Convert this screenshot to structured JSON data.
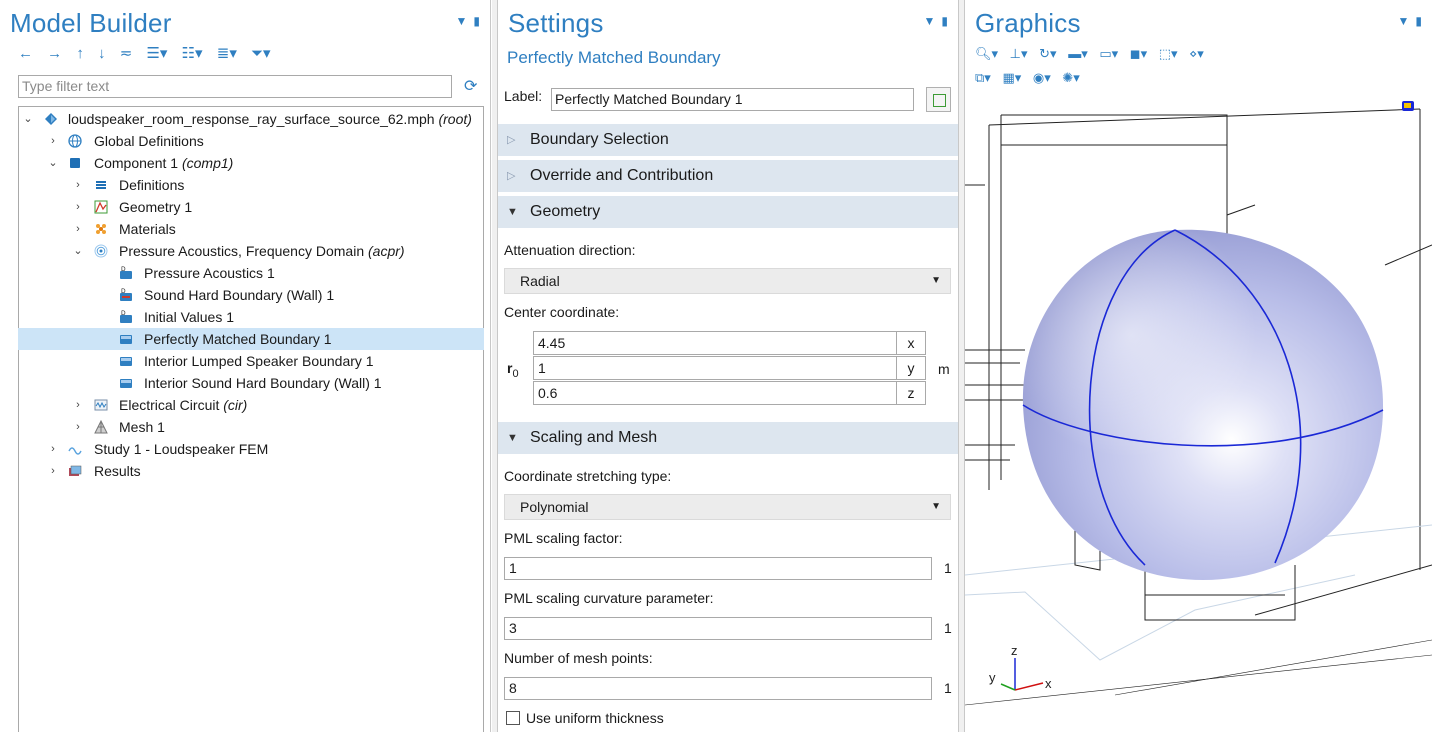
{
  "model_builder": {
    "title": "Model Builder",
    "filter_placeholder": "Type filter text",
    "tree": [
      {
        "label": "loudspeaker_room_response_ray_surface_source_62.mph",
        "tag": "(root)"
      },
      {
        "label": "Global Definitions",
        "tag": ""
      },
      {
        "label": "Component 1",
        "tag": "(comp1)"
      },
      {
        "label": "Definitions",
        "tag": ""
      },
      {
        "label": "Geometry 1",
        "tag": ""
      },
      {
        "label": "Materials",
        "tag": ""
      },
      {
        "label": "Pressure Acoustics, Frequency Domain",
        "tag": "(acpr)"
      },
      {
        "label": "Pressure Acoustics 1",
        "tag": ""
      },
      {
        "label": "Sound Hard Boundary (Wall) 1",
        "tag": ""
      },
      {
        "label": "Initial Values 1",
        "tag": ""
      },
      {
        "label": "Perfectly Matched Boundary 1",
        "tag": ""
      },
      {
        "label": "Interior Lumped Speaker Boundary 1",
        "tag": ""
      },
      {
        "label": "Interior Sound Hard Boundary (Wall) 1",
        "tag": ""
      },
      {
        "label": "Electrical Circuit",
        "tag": "(cir)"
      },
      {
        "label": "Mesh 1",
        "tag": ""
      },
      {
        "label": "Study 1 - Loudspeaker FEM",
        "tag": ""
      },
      {
        "label": "Results",
        "tag": ""
      }
    ]
  },
  "settings": {
    "title": "Settings",
    "subtitle": "Perfectly Matched Boundary",
    "label_caption": "Label:",
    "label_value": "Perfectly Matched Boundary 1",
    "sections": {
      "boundary_selection": "Boundary Selection",
      "override": "Override and Contribution",
      "geometry": "Geometry",
      "scaling": "Scaling and Mesh"
    },
    "attenuation_label": "Attenuation direction:",
    "attenuation_value": "Radial",
    "center_label": "Center coordinate:",
    "center_symbol": "r",
    "center_sub": "0",
    "center": [
      {
        "value": "4.45",
        "axis": "x"
      },
      {
        "value": "1",
        "axis": "y"
      },
      {
        "value": "0.6",
        "axis": "z"
      }
    ],
    "center_unit": "m",
    "stretch_label": "Coordinate stretching type:",
    "stretch_value": "Polynomial",
    "pml_scaling_label": "PML scaling factor:",
    "pml_scaling_value": "1",
    "pml_scaling_unit": "1",
    "pml_curv_label": "PML scaling curvature parameter:",
    "pml_curv_value": "3",
    "pml_curv_unit": "1",
    "mesh_points_label": "Number of mesh points:",
    "mesh_points_value": "8",
    "mesh_points_unit": "1",
    "uniform_label": "Use uniform thickness",
    "uniform_checked": false
  },
  "graphics": {
    "title": "Graphics",
    "axes": {
      "x": "x",
      "y": "y",
      "z": "z"
    },
    "sphere_color": "#b8bde8",
    "edge_color": "#1a28d6"
  },
  "colors": {
    "accent": "#2f7fc1",
    "selected_row": "#cce4f7",
    "section_bg": "#dde6ef"
  }
}
